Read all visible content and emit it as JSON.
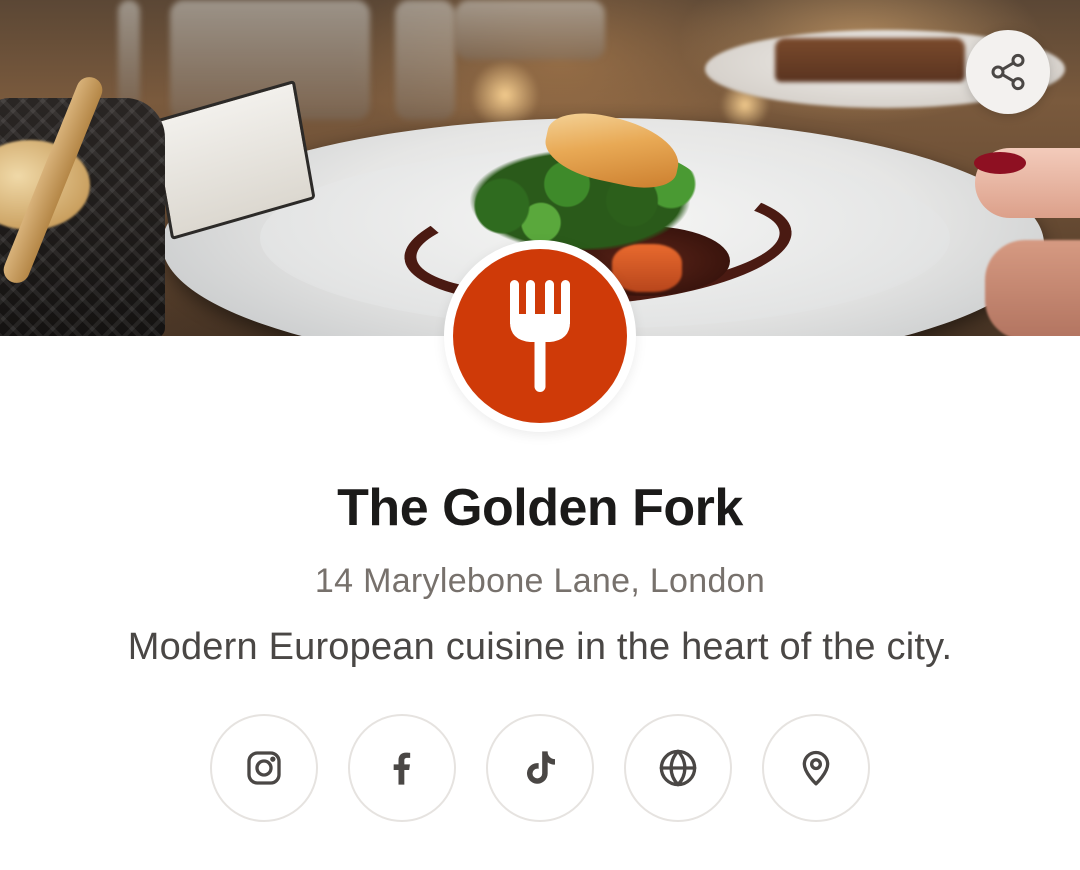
{
  "profile": {
    "name": "The Golden Fork",
    "address": "14 Marylebone Lane, London",
    "tagline": "Modern European cuisine in the heart of the city."
  },
  "hero": {
    "image_subject": "plated dish with fish, greens and sauce on a restaurant table"
  },
  "logo": {
    "icon": "fork-icon",
    "background_color": "#cf3a08"
  },
  "actions": {
    "share": {
      "icon": "share-icon"
    }
  },
  "socials": [
    {
      "icon": "instagram-icon"
    },
    {
      "icon": "facebook-icon"
    },
    {
      "icon": "tiktok-icon"
    },
    {
      "icon": "globe-icon"
    },
    {
      "icon": "location-pin-icon"
    }
  ],
  "colors": {
    "accent": "#cf3a08",
    "title_text": "#1b1a19",
    "subtitle_text": "#77716c",
    "body_text": "#4a4745",
    "icon_stroke": "#4a4745",
    "button_border": "#e6e3e0"
  }
}
